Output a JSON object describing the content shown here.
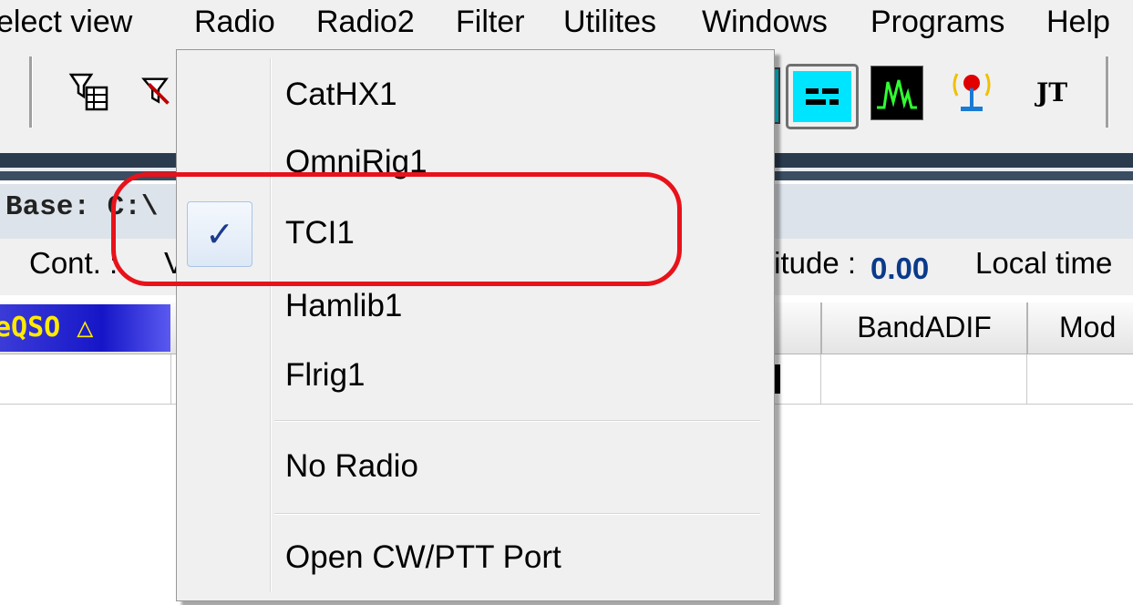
{
  "menubar": {
    "items": [
      "elect view",
      "Radio",
      "Radio2",
      "Filter",
      "Utilites",
      "Windows",
      "Programs",
      "Help"
    ]
  },
  "toolbar": {
    "jt_label": "JT"
  },
  "base": {
    "label": "Base: C:\\"
  },
  "info": {
    "cont_label": "Cont. :",
    "v_label": "V",
    "altitude_label": "titude :",
    "altitude_value": "0.00",
    "local_time_label": "Local time"
  },
  "grid": {
    "sorted_column": "eQSO △",
    "columns": [
      "BandADIF",
      "Mod"
    ]
  },
  "radio_menu": {
    "items": [
      {
        "label": "CatHX1",
        "checked": false
      },
      {
        "label": "OmniRig1",
        "checked": false
      },
      {
        "label": "TCI1",
        "checked": true
      },
      {
        "label": "Hamlib1",
        "checked": false
      },
      {
        "label": "Flrig1",
        "checked": false
      }
    ],
    "no_radio": "No Radio",
    "open_port": "Open CW/PTT Port",
    "check_glyph": "✓"
  },
  "colors": {
    "highlight_ring": "#e8121a",
    "checkmark": "#1c3b8c",
    "date_header_bg": "#1616c8",
    "date_header_text": "#ffea00",
    "cyan_button": "#00e5ff"
  }
}
